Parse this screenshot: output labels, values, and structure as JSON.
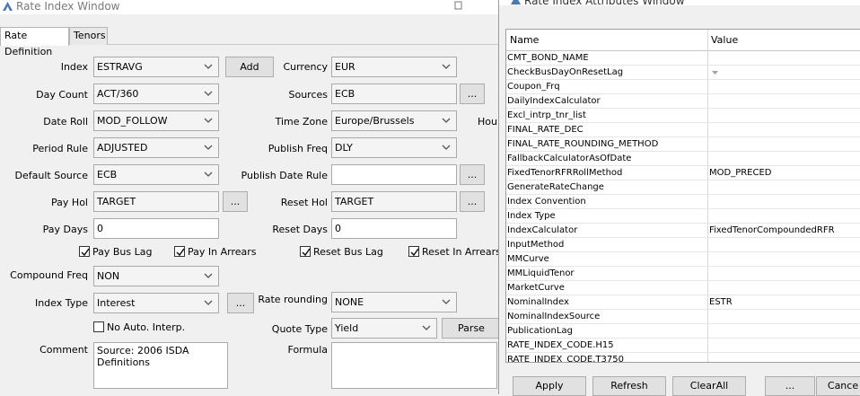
{
  "main_window": {
    "title": "Rate Index Window",
    "tabs": [
      "Rate Definition",
      "Tenors"
    ],
    "fields": {
      "index": {
        "label": "Index",
        "value": "ESTRAVG"
      },
      "add_button": "Add",
      "currency": {
        "label": "Currency",
        "value": "EUR"
      },
      "day_count": {
        "label": "Day Count",
        "value": "ACT/360"
      },
      "sources": {
        "label": "Sources",
        "value": "ECB"
      },
      "date_roll": {
        "label": "Date Roll",
        "value": "MOD_FOLLOW"
      },
      "time_zone": {
        "label": "Time Zone",
        "value": "Europe/Brussels"
      },
      "hour_label": "Hour",
      "period_rule": {
        "label": "Period Rule",
        "value": "ADJUSTED"
      },
      "publish_freq": {
        "label": "Publish Freq",
        "value": "DLY"
      },
      "default_source": {
        "label": "Default Source",
        "value": "ECB"
      },
      "publish_date_rule": {
        "label": "Publish Date Rule",
        "value": ""
      },
      "pay_hol": {
        "label": "Pay Hol",
        "value": "TARGET"
      },
      "reset_hol": {
        "label": "Reset Hol",
        "value": "TARGET"
      },
      "pay_days": {
        "label": "Pay Days",
        "value": "0"
      },
      "reset_days": {
        "label": "Reset Days",
        "value": "0"
      },
      "compound_freq": {
        "label": "Compound Freq",
        "value": "NON"
      },
      "index_type": {
        "label": "Index Type",
        "value": "Interest"
      },
      "rate_rounding": {
        "label": "Rate rounding",
        "value": "NONE"
      },
      "quote_type": {
        "label": "Quote Type",
        "value": "Yield"
      },
      "parse_button": "Parse",
      "comment": {
        "label": "Comment",
        "value": "Source: 2006 ISDA Definitions"
      },
      "formula": {
        "label": "Formula",
        "value": ""
      },
      "ellipsis": "..."
    },
    "checkboxes": {
      "pay_bus_lag": {
        "label": "Pay Bus Lag",
        "checked": true
      },
      "pay_in_arrears": {
        "label": "Pay In Arrears",
        "checked": true
      },
      "reset_bus_lag": {
        "label": "Reset Bus Lag",
        "checked": true
      },
      "reset_in_arrears": {
        "label": "Reset In Arrears",
        "checked": true
      },
      "no_auto_interp": {
        "label": "No Auto. Interp.",
        "checked": false
      }
    }
  },
  "attributes_window": {
    "title": "Rate Index Attributes Window",
    "columns": [
      "Name",
      "Value"
    ],
    "rows": [
      {
        "name": "CMT_BOND_NAME",
        "value": ""
      },
      {
        "name": "CheckBusDayOnResetLag",
        "value": ""
      },
      {
        "name": "Coupon_Frq",
        "value": ""
      },
      {
        "name": "DailyIndexCalculator",
        "value": ""
      },
      {
        "name": "Excl_intrp_tnr_list",
        "value": ""
      },
      {
        "name": "FINAL_RATE_DEC",
        "value": ""
      },
      {
        "name": "FINAL_RATE_ROUNDING_METHOD",
        "value": ""
      },
      {
        "name": "FallbackCalculatorAsOfDate",
        "value": ""
      },
      {
        "name": "FixedTenorRFRRollMethod",
        "value": "MOD_PRECED"
      },
      {
        "name": "GenerateRateChange",
        "value": ""
      },
      {
        "name": "Index Convention",
        "value": ""
      },
      {
        "name": "Index Type",
        "value": ""
      },
      {
        "name": "IndexCalculator",
        "value": "FixedTenorCompoundedRFR"
      },
      {
        "name": "InputMethod",
        "value": ""
      },
      {
        "name": "MMCurve",
        "value": ""
      },
      {
        "name": "MMLiquidTenor",
        "value": ""
      },
      {
        "name": "MarketCurve",
        "value": ""
      },
      {
        "name": "NominalIndex",
        "value": "ESTR"
      },
      {
        "name": "NominalIndexSource",
        "value": ""
      },
      {
        "name": "PublicationLag",
        "value": ""
      },
      {
        "name": "RATE_INDEX_CODE.H15",
        "value": ""
      },
      {
        "name": "RATE_INDEX_CODE.T3750",
        "value": ""
      }
    ],
    "buttons": [
      "Apply",
      "Refresh",
      "ClearAll",
      "...",
      "Cance"
    ]
  }
}
